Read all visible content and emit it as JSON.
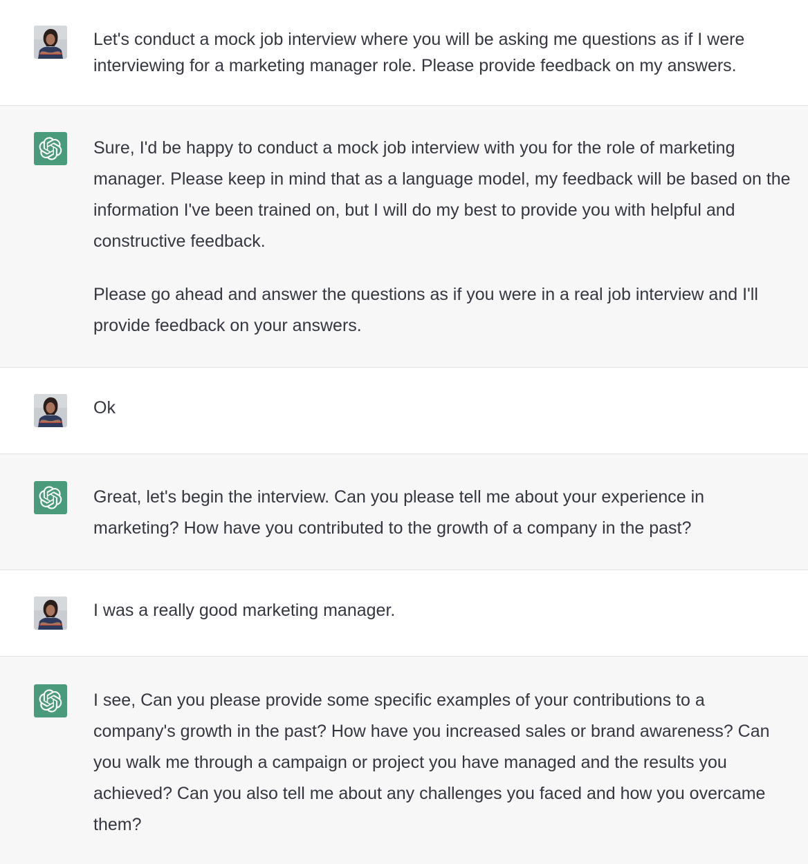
{
  "colors": {
    "user_bg": "#ffffff",
    "assistant_bg": "#f7f7f8",
    "assistant_avatar": "#4a9a7c",
    "text": "#353740",
    "divider": "#e3e3e6"
  },
  "icons": {
    "user": "user-photo-avatar",
    "assistant": "openai-logo-icon"
  },
  "messages": [
    {
      "role": "user",
      "paragraphs": [
        "Let's conduct a mock job interview where you will be asking me questions as if I were\ninterviewing for a marketing manager role. Please provide feedback on my answers."
      ]
    },
    {
      "role": "assistant",
      "paragraphs": [
        "Sure, I'd be happy to conduct a mock job interview with you for the role of marketing\nmanager. Please keep in mind that as a language model, my feedback will be based on the\ninformation I've been trained on, but I will do my best to provide you with helpful and\nconstructive feedback.",
        "Please go ahead and answer the questions as if you were in a real job interview and I'll\nprovide feedback on your answers."
      ]
    },
    {
      "role": "user",
      "paragraphs": [
        "Ok"
      ]
    },
    {
      "role": "assistant",
      "paragraphs": [
        "Great, let's begin the interview. Can you please tell me about your experience in\nmarketing? How have you contributed to the growth of a company in the past?"
      ]
    },
    {
      "role": "user",
      "paragraphs": [
        "I was a really good marketing manager."
      ]
    },
    {
      "role": "assistant",
      "paragraphs": [
        "I see, Can you please provide some specific examples of your contributions to a\ncompany's growth in the past? How have you increased sales or brand awareness? Can\nyou walk me through a campaign or project you have managed and the results you\nachieved? Can you also tell me about any challenges you faced and how you overcame\nthem?"
      ]
    }
  ]
}
